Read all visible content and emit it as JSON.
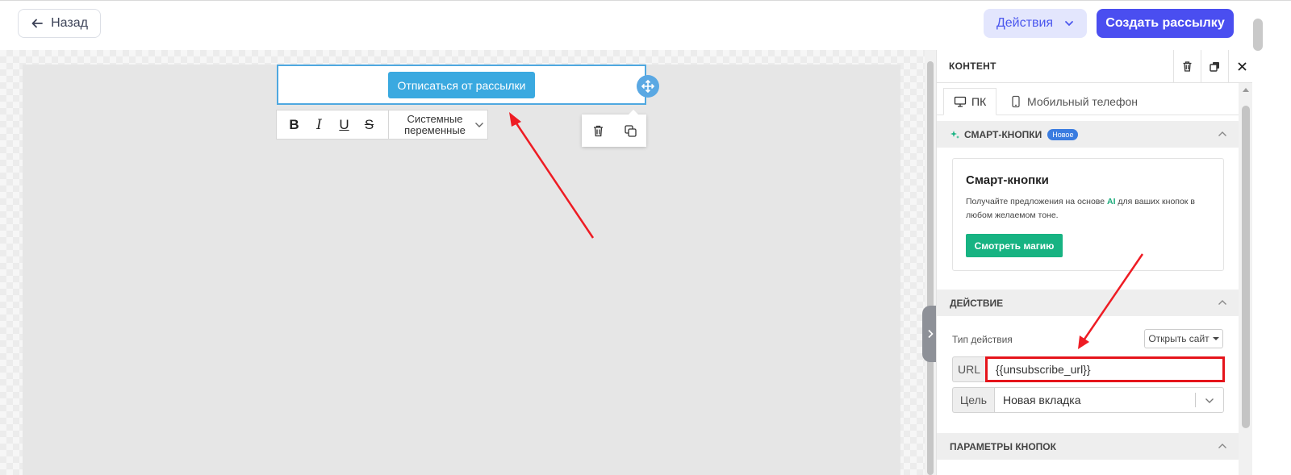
{
  "topbar": {
    "back_label": "Назад",
    "actions_label": "Действия",
    "create_label": "Создать рассылку"
  },
  "canvas": {
    "unsubscribe_button_label": "Отписаться от рассылки",
    "format_toolbar": {
      "bold": "B",
      "italic": "I",
      "underline": "U",
      "strike": "S",
      "system_vars_label": "Системные переменные"
    }
  },
  "panel": {
    "title": "КОНТЕНТ",
    "tabs": [
      {
        "label": "ПК",
        "icon": "monitor-icon",
        "active": true
      },
      {
        "label": "Мобильный телефон",
        "icon": "phone-icon",
        "active": false
      }
    ],
    "smart_section": {
      "header": "СМАРТ-КНОПКИ",
      "badge": "Новое",
      "card_title": "Смарт-кнопки",
      "desc_before": "Получайте предложения на основе ",
      "desc_ai": "AI",
      "desc_after": " для ваших кнопок в любом желаемом тоне.",
      "button_label": "Смотреть магию"
    },
    "action_section": {
      "header": "ДЕЙСТВИЕ",
      "type_label": "Тип действия",
      "type_value": "Открыть сайт",
      "url_label": "URL",
      "url_value": "{{unsubscribe_url}}",
      "target_label": "Цель",
      "target_value": "Новая вкладка"
    },
    "params_section": {
      "header": "ПАРАМЕТРЫ КНОПОК"
    }
  },
  "colors": {
    "primary": "#4a4ef0",
    "actions_bg": "#e3e6fd",
    "button_blue": "#3aa9e0",
    "green": "#17b382",
    "highlight_red": "#e5141b"
  }
}
